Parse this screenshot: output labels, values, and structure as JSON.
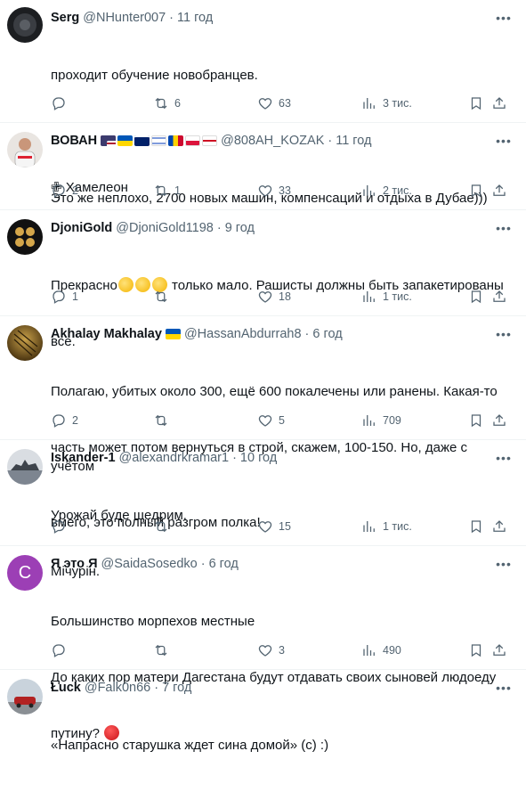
{
  "posts": [
    {
      "name": "Serg",
      "handle": "@NHunter007",
      "sep": "·",
      "time": "11 год",
      "lines": [
        "проходит обучение новобранцев.",
        "",
        "✙ Хамелеон"
      ],
      "reply": "",
      "retweets": "6",
      "likes": "63",
      "views": "3 тис."
    },
    {
      "name": "ВОВАН",
      "handle": "@808AH_KOZAK",
      "sep": "·",
      "time": "11 год",
      "lines": [
        "Это же неплохо, 2700 новых машин, компенсаций и отдыха в Дубае)))"
      ],
      "reply": "2",
      "retweets": "1",
      "likes": "33",
      "views": "2 тис."
    },
    {
      "name": "DjoniGold",
      "handle": "@DjoniGold1198",
      "sep": "·",
      "time": "9 год",
      "line1_before": "Прекрасно",
      "line1_after": " только мало. Рашисты должны быть запакетированы",
      "lines": [
        "все."
      ],
      "reply": "1",
      "retweets": "",
      "likes": "18",
      "views": "1 тис."
    },
    {
      "name": "Akhalay Makhalay",
      "handle": "@HassanAbdurrah8",
      "sep": "·",
      "time": "6 год",
      "lines": [
        "Полагаю, убитых около 300, ещё 600 покалечены или ранены. Какая-то",
        "часть может потом вернуться в строй, скажем, 100-150. Но, даже с учётом",
        "вмего, это полный разгром полка!"
      ],
      "reply": "2",
      "retweets": "",
      "likes": "5",
      "views": "709"
    },
    {
      "name": "Iskander-1",
      "handle": "@alexandrkramar1",
      "sep": "·",
      "time": "10 год",
      "lines": [
        "Урожай буде щедрим.",
        "Мічурін."
      ],
      "reply": "",
      "retweets": "",
      "likes": "15",
      "views": "1 тис."
    },
    {
      "name": "Я это Я",
      "handle": "@SaidaSosedko",
      "sep": "·",
      "time": "6 год",
      "avatar_letter": "C",
      "lines": [
        "Большинство морпехов местные",
        "До каких пор матери Дагестана будут отдавать своих сыновей людоеду"
      ],
      "last_line": "путину? ",
      "reply": "",
      "retweets": "",
      "likes": "3",
      "views": "490"
    },
    {
      "name": "Łuck",
      "handle": "@Falk0n66",
      "sep": "·",
      "time": "7 год",
      "lines": [
        "«Напрасно старушка ждет сина домой» (с) :)"
      ]
    }
  ],
  "icons": {
    "reply": "reply-icon",
    "retweet": "retweet-icon",
    "like": "heart-icon",
    "views": "views-icon",
    "bookmark": "bookmark-icon",
    "share": "share-icon",
    "more": "more-icon"
  },
  "colors": {
    "text": "#0f1419",
    "secondary": "#536471",
    "divider": "#eff3f4",
    "avatar_letter_bg": "#9c3fb5"
  }
}
